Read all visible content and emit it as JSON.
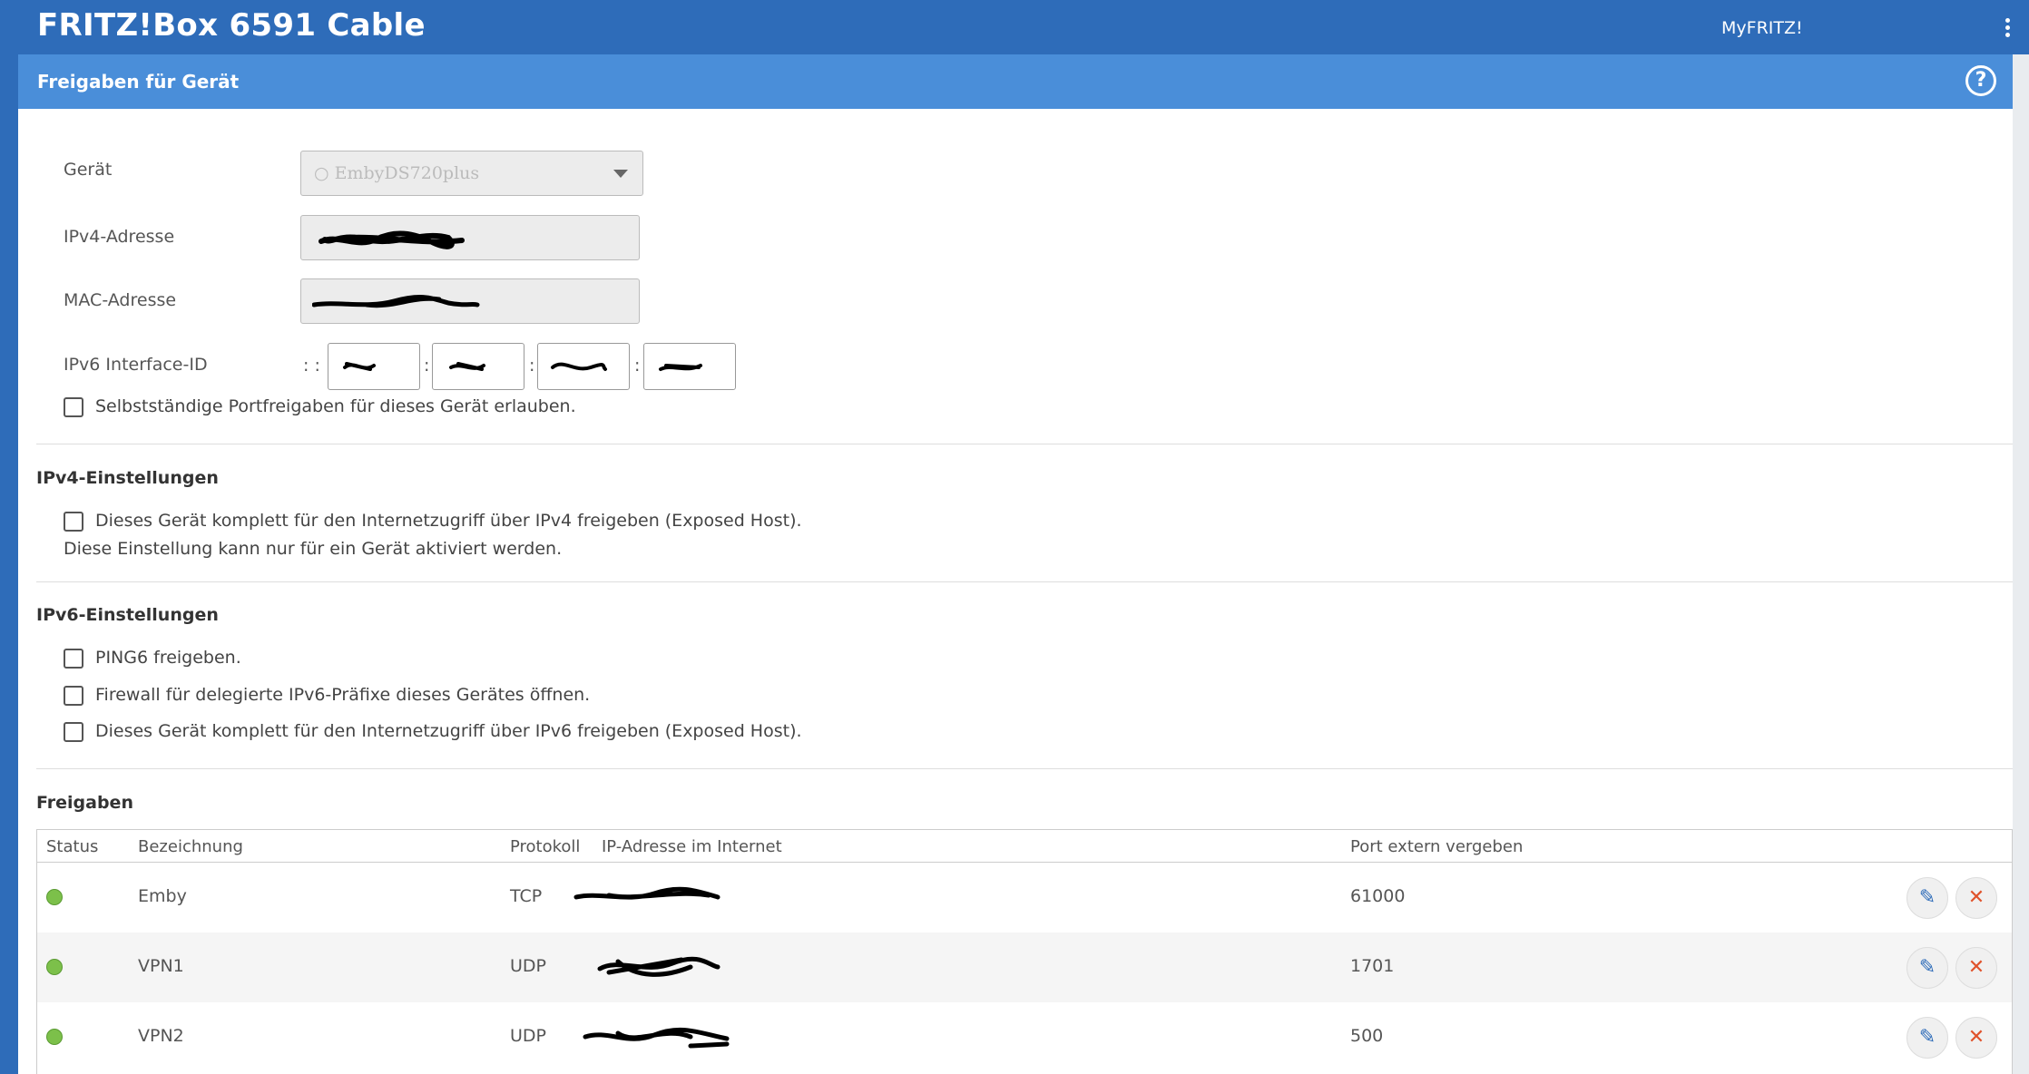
{
  "header": {
    "brand": "FRITZ!Box 6591 Cable",
    "myfritz": "MyFRITZ!",
    "menu_icon": "kebab-icon"
  },
  "subheader": {
    "title": "Freigaben für Gerät",
    "help_icon": "help-icon",
    "help_glyph": "?"
  },
  "device": {
    "geraet_label": "Gerät",
    "geraet_value": "○ EmbyDS720plus",
    "ipv4_label": "IPv4-Adresse",
    "mac_label": "MAC-Adresse",
    "ipv6_label": "IPv6 Interface-ID",
    "ipv6_prefix": ": :",
    "ipv6_sep": ":",
    "self_portfw_label": "Selbstständige Portfreigaben für dieses Gerät erlauben."
  },
  "ipv4_settings": {
    "title": "IPv4-Einstellungen",
    "exposed_host_label": "Dieses Gerät komplett für den Internetzugriff über IPv4 freigeben (Exposed Host).",
    "note": "Diese Einstellung kann nur für ein Gerät aktiviert werden."
  },
  "ipv6_settings": {
    "title": "IPv6-Einstellungen",
    "ping6_label": "PING6 freigeben.",
    "firewall_label": "Firewall für delegierte IPv6-Präfixe dieses Gerätes öffnen.",
    "exposed_host_label": "Dieses Gerät komplett für den Internetzugriff über IPv6 freigeben (Exposed Host)."
  },
  "freigaben": {
    "title": "Freigaben",
    "columns": [
      "Status",
      "Bezeichnung",
      "Protokoll",
      "IP-Adresse im Internet",
      "Port extern vergeben"
    ],
    "rows": [
      {
        "name": "Emby",
        "protocol": "TCP",
        "port": "61000"
      },
      {
        "name": "VPN1",
        "protocol": "UDP",
        "port": "1701"
      },
      {
        "name": "VPN2",
        "protocol": "UDP",
        "port": "500"
      }
    ],
    "edit_glyph": "✎",
    "delete_glyph": "✕"
  },
  "colors": {
    "topbar": "#2e6cb9",
    "subbar": "#4a8ed9",
    "status_ok": "#7cc04a",
    "delete": "#e0522b"
  }
}
